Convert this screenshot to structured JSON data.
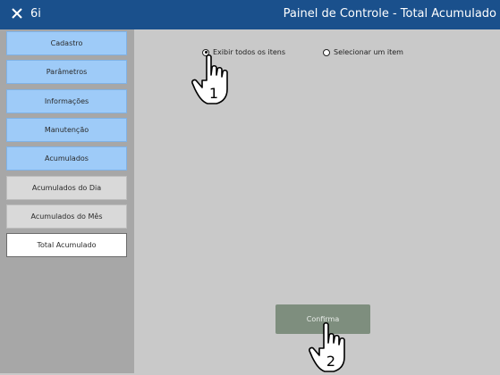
{
  "titlebar": {
    "app_label": "6i",
    "title": "Painel de Controle - Total Acumulado"
  },
  "sidebar": {
    "items": [
      {
        "label": "Cadastro"
      },
      {
        "label": "Parâmetros"
      },
      {
        "label": "Informações"
      },
      {
        "label": "Manutenção"
      },
      {
        "label": "Acumulados"
      },
      {
        "label": "Acumulados do Dia"
      },
      {
        "label": "Acumulados do Mês"
      },
      {
        "label": "Total Acumulado"
      }
    ]
  },
  "main": {
    "radio_all": {
      "label": "Exibir todos os itens",
      "checked": true
    },
    "radio_one": {
      "label": "Selecionar um item",
      "checked": false
    },
    "confirm_label": "Confirma"
  },
  "annotations": {
    "step1": "1",
    "step2": "2"
  },
  "colors": {
    "titlebar": "#1a508c",
    "nav_blue": "#9ecbf8",
    "nav_gray": "#d9d9d9",
    "sidebar_bg": "#a7a7a7",
    "main_bg": "#c9c9c9",
    "confirm_bg": "#7e8e7e"
  }
}
